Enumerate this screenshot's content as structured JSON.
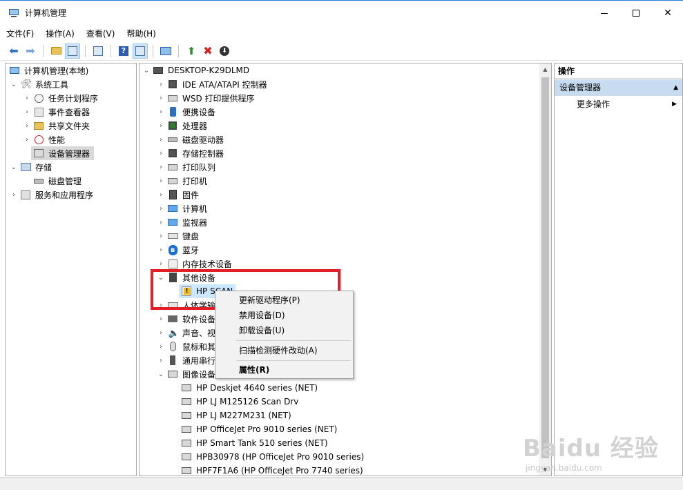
{
  "window": {
    "title": "计算机管理"
  },
  "menu": [
    "文件(F)",
    "操作(A)",
    "查看(V)",
    "帮助(H)"
  ],
  "left_tree": {
    "root": "计算机管理(本地)",
    "system_tools": "系统工具",
    "task_scheduler": "任务计划程序",
    "event_viewer": "事件查看器",
    "shared_folders": "共享文件夹",
    "performance": "性能",
    "device_manager": "设备管理器",
    "storage": "存储",
    "disk_management": "磁盘管理",
    "services_apps": "服务和应用程序"
  },
  "device_tree": {
    "computer": "DESKTOP-K29DLMD",
    "categories": [
      "IDE ATA/ATAPI 控制器",
      "WSD 打印提供程序",
      "便携设备",
      "处理器",
      "磁盘驱动器",
      "存储控制器",
      "打印队列",
      "打印机",
      "固件",
      "计算机",
      "监视器",
      "键盘",
      "蓝牙",
      "内存技术设备",
      "其他设备"
    ],
    "other_child": "HP SCAN",
    "hidden_categories": [
      "人体学输",
      "软件设备",
      "声音、视",
      "鼠标和其",
      "通用串行",
      "图像设备"
    ],
    "imaging_children": [
      "HP Deskjet 4640 series (NET)",
      "HP LJ M125126 Scan Drv",
      "HP LJ M227M231 (NET)",
      "HP OfficeJet Pro 9010 series (NET)",
      "HP Smart Tank 510 series (NET)",
      "HPB30978 (HP OfficeJet Pro 9010 series)",
      "HPF7F1A6 (HP OfficeJet Pro 7740 series)"
    ]
  },
  "actions": {
    "header": "操作",
    "section": "设备管理器",
    "more": "更多操作"
  },
  "context_menu": {
    "update_driver": "更新驱动程序(P)",
    "disable": "禁用设备(D)",
    "uninstall": "卸载设备(U)",
    "scan": "扫描检测硬件改动(A)",
    "properties": "属性(R)"
  },
  "watermark": {
    "main": "Baidu 经验",
    "sub": "jingyan.baidu.com"
  },
  "colors": {
    "highlight": "#e2202c",
    "selection": "#cce8ff",
    "action_section": "#c7dcf0"
  }
}
